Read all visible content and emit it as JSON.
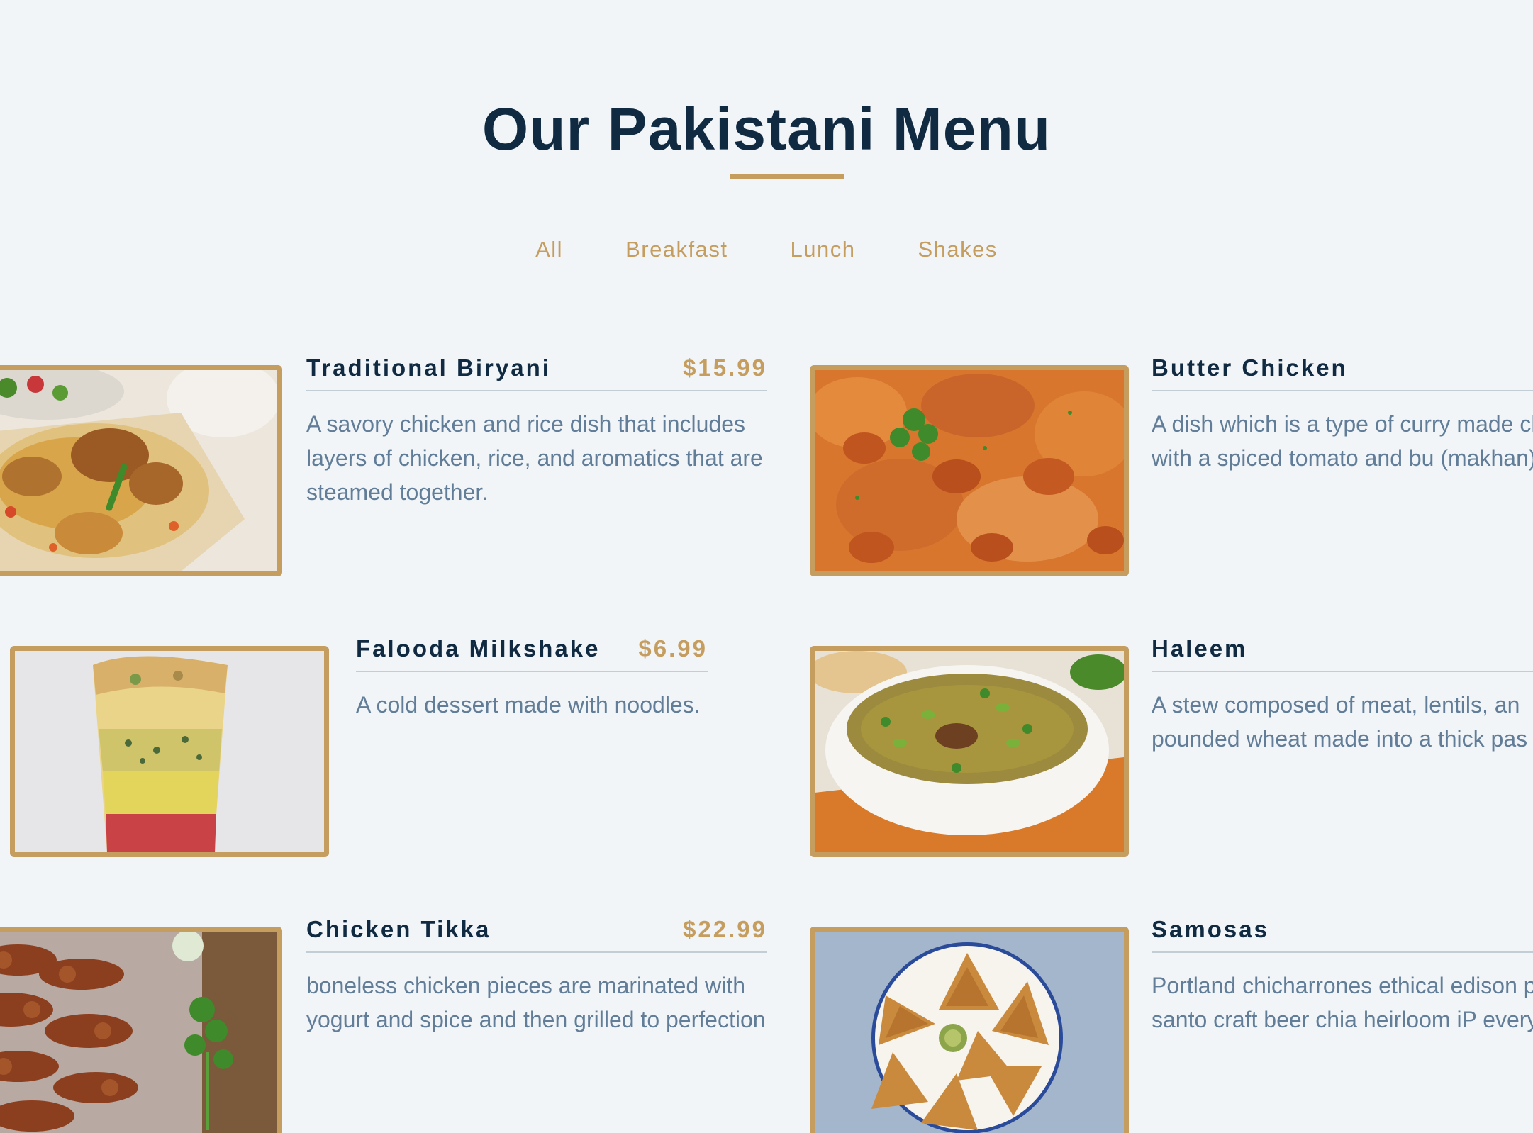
{
  "header": {
    "title": "Our Pakistani Menu"
  },
  "filters": [
    {
      "label": "All"
    },
    {
      "label": "Breakfast"
    },
    {
      "label": "Lunch"
    },
    {
      "label": "Shakes"
    }
  ],
  "colors": {
    "background": "#f1f5f8",
    "title": "#102a42",
    "accent": "#c59d5f",
    "description": "#617d98",
    "divider": "#c3cdd6"
  },
  "items": [
    {
      "name": "Traditional Biryani",
      "price": "$15.99",
      "description": "A savory chicken and rice dish that includes layers of chicken, rice, and aromatics that are steamed together.",
      "image": "biryani-photo"
    },
    {
      "name": "Butter Chicken",
      "price": "",
      "description": "A dish which is a type of curry made chicken with a spiced tomato and bu (makhan) sauce",
      "image": "butter-chicken-photo"
    },
    {
      "name": "Falooda Milkshake",
      "price": "$6.99",
      "description": "A cold dessert made with noodles.",
      "image": "falooda-photo"
    },
    {
      "name": "Haleem",
      "price": "",
      "description": "A stew composed of meat, lentils, an pounded wheat made into a thick pas",
      "image": "haleem-photo"
    },
    {
      "name": "Chicken Tikka",
      "price": "$22.99",
      "description": "boneless chicken pieces are marinated with yogurt and spice and then grilled to perfection",
      "image": "chicken-tikka-photo"
    },
    {
      "name": "Samosas",
      "price": "",
      "description": "Portland chicharrones ethical edison palo santo craft beer chia heirloom iP everyday",
      "image": "samosas-photo"
    }
  ]
}
